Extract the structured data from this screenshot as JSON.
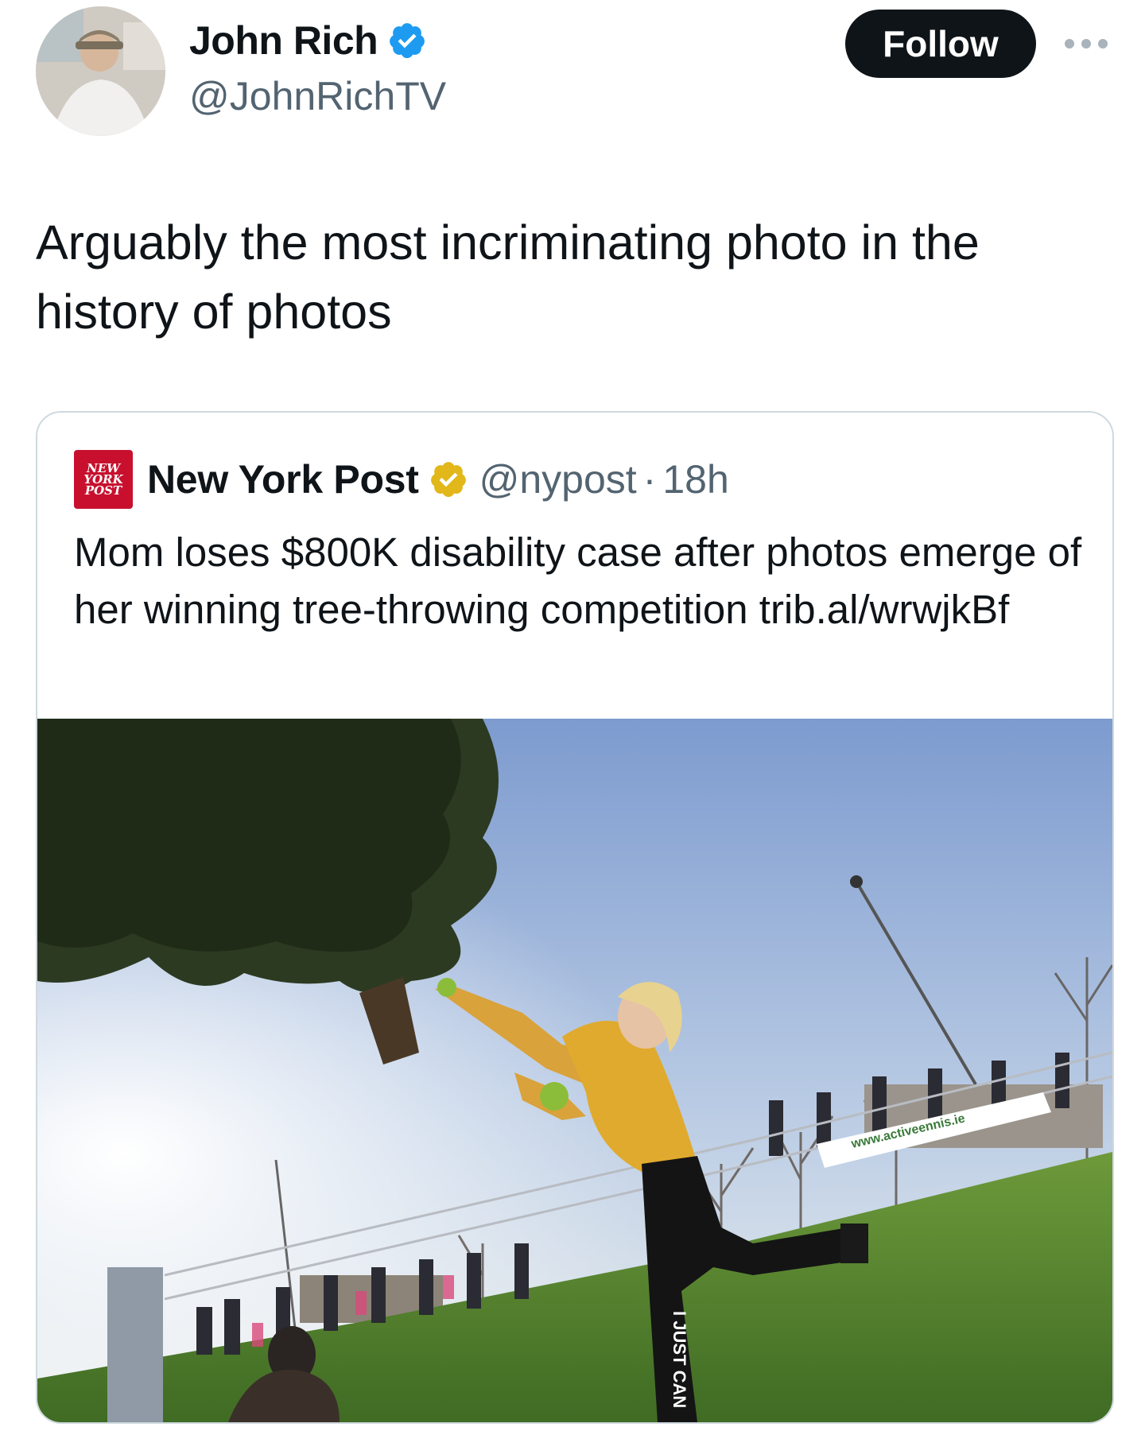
{
  "tweet": {
    "author": {
      "name": "John Rich",
      "handle": "@JohnRichTV"
    },
    "follow_label": "Follow",
    "text": "Arguably the most incriminating photo in the history of photos"
  },
  "quote": {
    "logo_lines": [
      "NEW",
      "YORK",
      "POST"
    ],
    "name": "New York Post",
    "handle": "@nypost",
    "separator": "·",
    "time": "18h",
    "text": "Mom loses $800K disability case after photos emerge of her winning tree-throwing competition trib.al/wrwjkBf",
    "photo": {
      "banner_text": "www.activeennis.ie",
      "leggings_text": "I JUST CAN"
    }
  },
  "colors": {
    "verified_blue": "#1d9bf0",
    "gold_badge": "#e2b719",
    "nyp_red": "#c8102e",
    "follow_bg": "#0f1419",
    "secondary_text": "#536471"
  },
  "icons": [
    "verified-badge-icon",
    "more-icon",
    "gold-verified-badge-icon"
  ]
}
